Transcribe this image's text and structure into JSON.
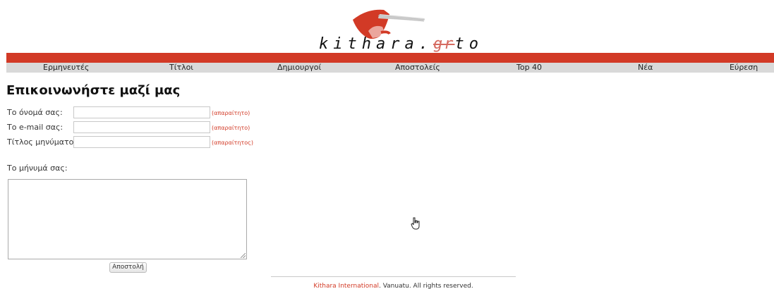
{
  "logo": {
    "brand": "kithara",
    "dot": ".",
    "tld_struck": "gr",
    "tld": "to"
  },
  "nav": {
    "items": [
      "Ερμηνευτές",
      "Τίτλοι",
      "Δημιουργοί",
      "Αποστολείς",
      "Top 40",
      "Νέα",
      "Εύρεση"
    ]
  },
  "page": {
    "title": "Επικοινωνήστε μαζί μας"
  },
  "form": {
    "name_label": "Το όνομά σας:",
    "name_required": "(απαραίτητο)",
    "email_label": "Το e-mail σας:",
    "email_required": "(απαραίτητο)",
    "subject_label": "Τίτλος μηνύματος:",
    "subject_required": "(απαραίτητος)",
    "message_label": "Το μήνυμά σας:",
    "submit_label": "Αποστολή"
  },
  "footer": {
    "company": "Kithara International",
    "rest": ". Vanuatu. All rights reserved."
  },
  "colors": {
    "accent": "#d23a26",
    "nav_bg": "#d9d9d9"
  }
}
